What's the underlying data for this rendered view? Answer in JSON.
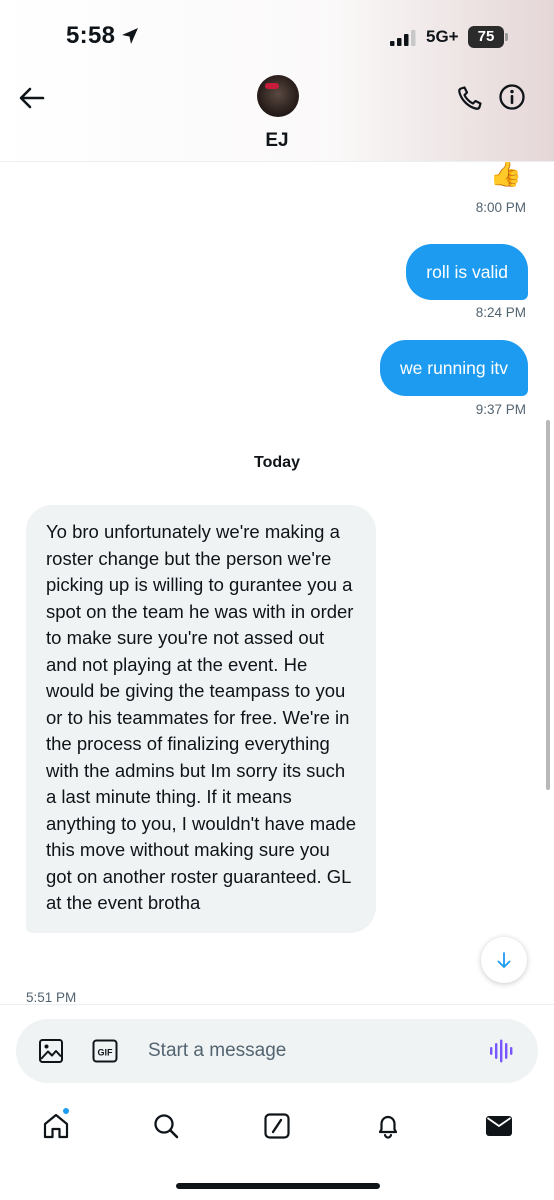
{
  "status_bar": {
    "time": "5:58",
    "network": "5G+",
    "battery": "75"
  },
  "header": {
    "contact_name": "EJ"
  },
  "conversation": {
    "reaction_emoji": "👍",
    "messages": [
      {
        "direction": "incoming",
        "type": "reaction",
        "time": "8:00 PM"
      },
      {
        "direction": "outgoing",
        "text": "roll is valid",
        "time": "8:24 PM"
      },
      {
        "direction": "outgoing",
        "text": "we running itv",
        "time": "9:37 PM"
      },
      {
        "direction": "incoming",
        "text": "Yo bro unfortunately we're making a roster change but the person we're picking up is willing to gurantee you a spot on the team he was with in order to make sure you're not assed out and not playing at the event. He would be giving the teampass to you or to his teammates for free. We're in the process of finalizing everything with the admins but Im sorry its such a last minute thing. If it means anything to you, I wouldn't have made this move without making sure you got on another roster guaranteed. GL at the event brotha",
        "time": "5:51 PM"
      }
    ],
    "day_divider": "Today"
  },
  "composer": {
    "placeholder": "Start a message",
    "value": ""
  },
  "tabs": [
    "home",
    "search",
    "grok",
    "notifications",
    "messages"
  ],
  "colors": {
    "accent": "#1d9bf0",
    "incoming_bubble": "#eff3f4",
    "secondary_text": "#536471",
    "voice_icon": "#7856ff"
  }
}
